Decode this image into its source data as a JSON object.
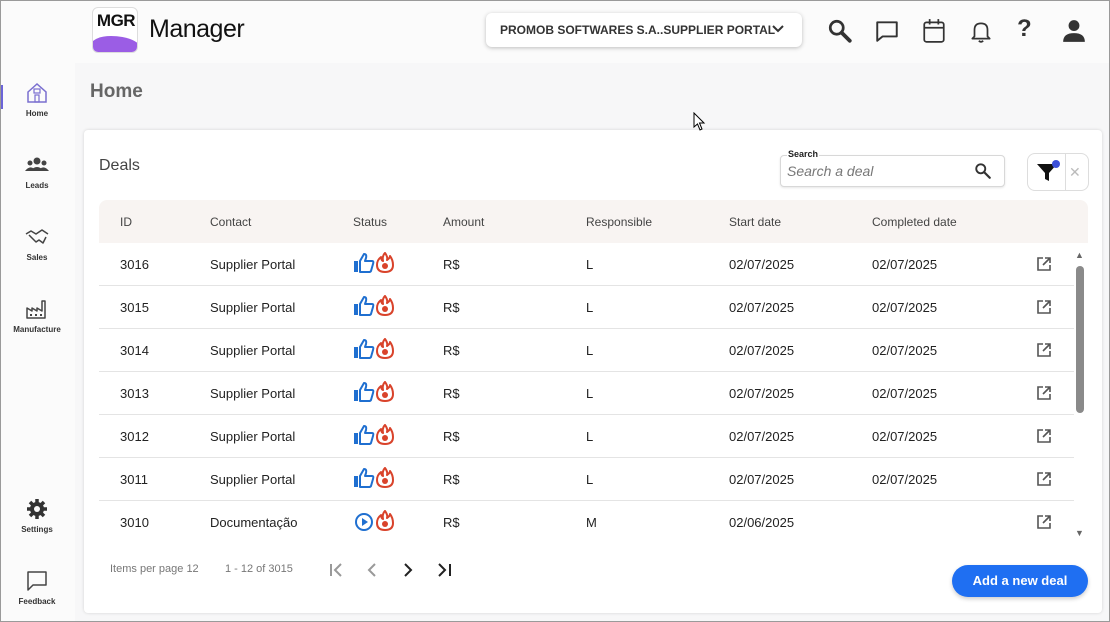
{
  "app": {
    "logo_text": "MGR",
    "title": "Manager",
    "org_select": "PROMOB SOFTWARES S.A..SUPPLIER PORTAL"
  },
  "header_icons": [
    "search-icon",
    "chat-icon",
    "calendar-icon",
    "bell-icon",
    "help-icon",
    "user-icon"
  ],
  "sidebar": {
    "items": [
      {
        "label": "Home",
        "icon": "home-icon",
        "active": true
      },
      {
        "label": "Leads",
        "icon": "people-icon",
        "active": false
      },
      {
        "label": "Sales",
        "icon": "handshake-icon",
        "active": false
      },
      {
        "label": "Manufacture",
        "icon": "factory-icon",
        "active": false
      }
    ],
    "bottom": [
      {
        "label": "Settings",
        "icon": "gear-icon"
      },
      {
        "label": "Feedback",
        "icon": "feedback-icon"
      }
    ]
  },
  "page": {
    "title": "Home"
  },
  "deals": {
    "title": "Deals",
    "search": {
      "label": "Search",
      "placeholder": "Search a deal"
    },
    "columns": [
      "ID",
      "Contact",
      "Status",
      "Amount",
      "Responsible",
      "Start date",
      "Completed date"
    ],
    "rows": [
      {
        "id": "3016",
        "contact": "Supplier Portal",
        "status": "approved",
        "amount": "R$",
        "responsible": "L",
        "start": "02/07/2025",
        "completed": "02/07/2025"
      },
      {
        "id": "3015",
        "contact": "Supplier Portal",
        "status": "approved",
        "amount": "R$",
        "responsible": "L",
        "start": "02/07/2025",
        "completed": "02/07/2025"
      },
      {
        "id": "3014",
        "contact": "Supplier Portal",
        "status": "approved",
        "amount": "R$",
        "responsible": "L",
        "start": "02/07/2025",
        "completed": "02/07/2025"
      },
      {
        "id": "3013",
        "contact": "Supplier Portal",
        "status": "approved",
        "amount": "R$",
        "responsible": "L",
        "start": "02/07/2025",
        "completed": "02/07/2025"
      },
      {
        "id": "3012",
        "contact": "Supplier Portal",
        "status": "approved",
        "amount": "R$",
        "responsible": "L",
        "start": "02/07/2025",
        "completed": "02/07/2025"
      },
      {
        "id": "3011",
        "contact": "Supplier Portal",
        "status": "approved",
        "amount": "R$",
        "responsible": "L",
        "start": "02/07/2025",
        "completed": "02/07/2025"
      },
      {
        "id": "3010",
        "contact": "Documentação",
        "status": "in-progress",
        "amount": "R$",
        "responsible": "M",
        "start": "02/06/2025",
        "completed": ""
      }
    ],
    "pagination": {
      "items_per_page_label": "Items per page",
      "items_per_page": "12",
      "range": "1 - 12 of 3015"
    },
    "add_button": "Add a new deal"
  },
  "colors": {
    "accent": "#1f6ff2",
    "brand_purple": "#9b5de5",
    "hot": "#d9432b"
  }
}
